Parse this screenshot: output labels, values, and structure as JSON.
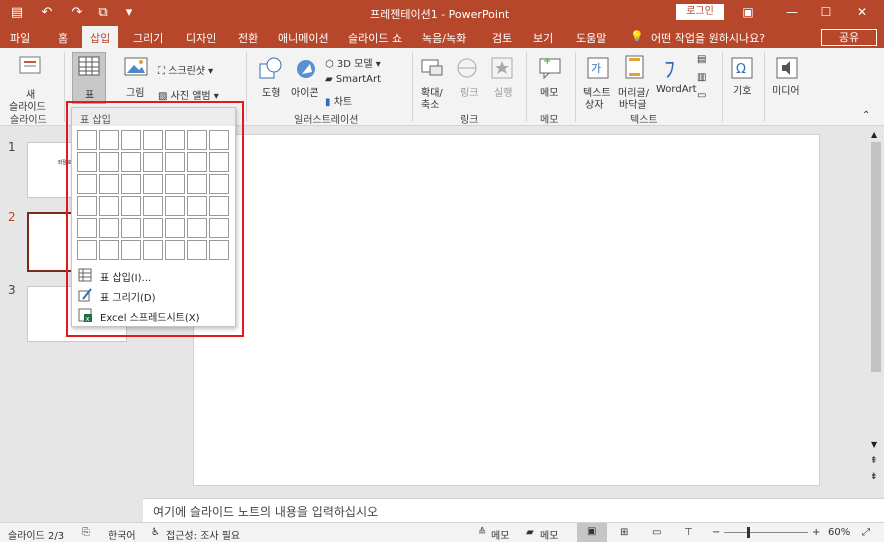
{
  "titlebar": {
    "title": "프레젠테이션1 - PowerPoint",
    "login": "로그인"
  },
  "tabs": [
    "파일",
    "홈",
    "삽입",
    "그리기",
    "디자인",
    "전환",
    "애니메이션",
    "슬라이드 쇼",
    "녹음/녹화",
    "검토",
    "보기",
    "도움말"
  ],
  "tell_me": "어떤 작업을 원하시나요?",
  "share": "공유",
  "ribbon": {
    "new_slide": "새",
    "new_slide2": "슬라이드",
    "slides_group": "슬라이드",
    "table": "표",
    "picture": "그림",
    "screenshot": "스크린샷",
    "photo_album": "사진 앨범",
    "shapes": "도형",
    "icons": "아이콘",
    "model3d": "3D 모델",
    "smartart": "SmartArt",
    "chart": "차트",
    "illustrations_group": "일러스트레이션",
    "zoom": "확대/",
    "zoom2": "축소",
    "link": "링크",
    "action": "실행",
    "links_group": "링크",
    "comment": "메모",
    "comments_group": "메모",
    "textbox": "텍스트",
    "textbox2": "상자",
    "header": "머리글/",
    "header2": "바닥글",
    "wordart": "WordArt",
    "text_group": "텍스트",
    "symbols": "기호",
    "media": "미디어"
  },
  "slides": [
    {
      "num": "1",
      "text": "좌절로인해 고통받 은"
    },
    {
      "num": "2",
      "text": ""
    },
    {
      "num": "3",
      "text": ""
    }
  ],
  "dropdown": {
    "header": "표 삽입",
    "items": [
      {
        "label": "표 삽입(I)..."
      },
      {
        "label": "표 그리기(D)"
      },
      {
        "label": "Excel 스프레드시트(X)"
      }
    ]
  },
  "notes_placeholder": "여기에 슬라이드 노트의 내용을 입력하십시오",
  "status": {
    "slide_info": "슬라이드 2/3",
    "language": "한국어",
    "accessibility": "접근성: 조사 필요",
    "notes": "메모",
    "comments": "메모",
    "zoom": "60%"
  },
  "colors": {
    "accent": "#b7472a",
    "highlight": "#e01b1b"
  }
}
